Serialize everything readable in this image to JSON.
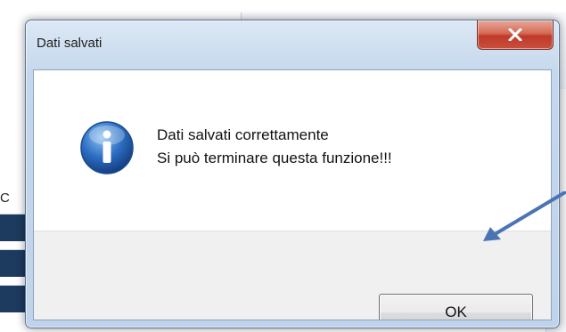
{
  "background": {
    "left_fragment_text": "C"
  },
  "dialog": {
    "title": "Dati salvati",
    "close_icon": "close-x-icon",
    "info_icon": "information-icon",
    "message_line1": "Dati salvati correttamente",
    "message_line2": "Si può terminare questa funzione!!!",
    "ok_label": "OK"
  },
  "annotation": {
    "arrow_icon": "pointer-arrow-icon",
    "arrow_color": "#4a74b4"
  },
  "colors": {
    "close_button": "#c9503c",
    "info_icon": "#2d6fc4",
    "window_frame": "#c4d7ec"
  }
}
